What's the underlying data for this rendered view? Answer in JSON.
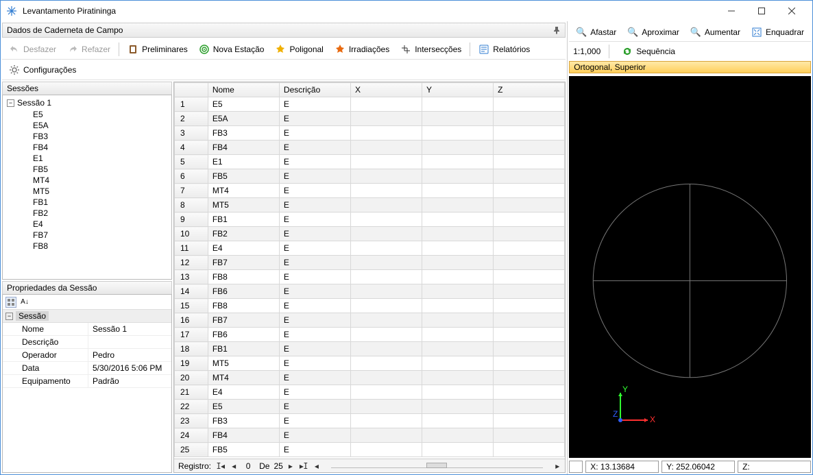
{
  "window": {
    "title": "Levantamento Piratininga"
  },
  "panel": {
    "title": "Dados de Caderneta de Campo"
  },
  "toolbar": {
    "undo": "Desfazer",
    "redo": "Refazer",
    "prelim": "Preliminares",
    "nova": "Nova Estação",
    "polig": "Poligonal",
    "irrad": "Irradiações",
    "inter": "Intersecções",
    "relat": "Relatórios",
    "config": "Configurações"
  },
  "sessions": {
    "header": "Sessões",
    "root": "Sessão 1",
    "items": [
      "E5",
      "E5A",
      "FB3",
      "FB4",
      "E1",
      "FB5",
      "MT4",
      "MT5",
      "FB1",
      "FB2",
      "E4",
      "FB7",
      "FB8"
    ]
  },
  "props": {
    "header": "Propriedades da Sessão",
    "category": "Sessão",
    "rows": [
      {
        "k": "Nome",
        "v": "Sessão 1"
      },
      {
        "k": "Descrição",
        "v": ""
      },
      {
        "k": "Operador",
        "v": "Pedro"
      },
      {
        "k": "Data",
        "v": "5/30/2016 5:06 PM"
      },
      {
        "k": "Equipamento",
        "v": "Padrão"
      }
    ]
  },
  "grid": {
    "cols": [
      "",
      "Nome",
      "Descrição",
      "X",
      "Y",
      "Z"
    ],
    "rows": [
      {
        "n": 1,
        "nome": "E5",
        "desc": "E"
      },
      {
        "n": 2,
        "nome": "E5A",
        "desc": "E"
      },
      {
        "n": 3,
        "nome": "FB3",
        "desc": "E"
      },
      {
        "n": 4,
        "nome": "FB4",
        "desc": "E"
      },
      {
        "n": 5,
        "nome": "E1",
        "desc": "E"
      },
      {
        "n": 6,
        "nome": "FB5",
        "desc": "E"
      },
      {
        "n": 7,
        "nome": "MT4",
        "desc": "E"
      },
      {
        "n": 8,
        "nome": "MT5",
        "desc": "E"
      },
      {
        "n": 9,
        "nome": "FB1",
        "desc": "E"
      },
      {
        "n": 10,
        "nome": "FB2",
        "desc": "E"
      },
      {
        "n": 11,
        "nome": "E4",
        "desc": "E"
      },
      {
        "n": 12,
        "nome": "FB7",
        "desc": "E"
      },
      {
        "n": 13,
        "nome": "FB8",
        "desc": "E"
      },
      {
        "n": 14,
        "nome": "FB6",
        "desc": "E"
      },
      {
        "n": 15,
        "nome": "FB8",
        "desc": "E"
      },
      {
        "n": 16,
        "nome": "FB7",
        "desc": "E"
      },
      {
        "n": 17,
        "nome": "FB6",
        "desc": "E"
      },
      {
        "n": 18,
        "nome": "FB1",
        "desc": "E"
      },
      {
        "n": 19,
        "nome": "MT5",
        "desc": "E"
      },
      {
        "n": 20,
        "nome": "MT4",
        "desc": "E"
      },
      {
        "n": 21,
        "nome": "E4",
        "desc": "E"
      },
      {
        "n": 22,
        "nome": "E5",
        "desc": "E"
      },
      {
        "n": 23,
        "nome": "FB3",
        "desc": "E"
      },
      {
        "n": 24,
        "nome": "FB4",
        "desc": "E"
      },
      {
        "n": 25,
        "nome": "FB5",
        "desc": "E"
      }
    ],
    "nav": {
      "label": "Registro:",
      "of": "De",
      "total": "25",
      "current": "0"
    }
  },
  "right": {
    "zoom_out": "Afastar",
    "zoom_in": "Aproximar",
    "magnify": "Aumentar",
    "fit": "Enquadrar",
    "scale": "1:1,000",
    "seq": "Sequência",
    "view": "Ortogonal, Superior",
    "status_x": "X: 13.13684",
    "status_y": "Y: 252.06042",
    "status_z": "Z:",
    "axis_x": "X",
    "axis_y": "Y",
    "axis_z": "Z"
  }
}
